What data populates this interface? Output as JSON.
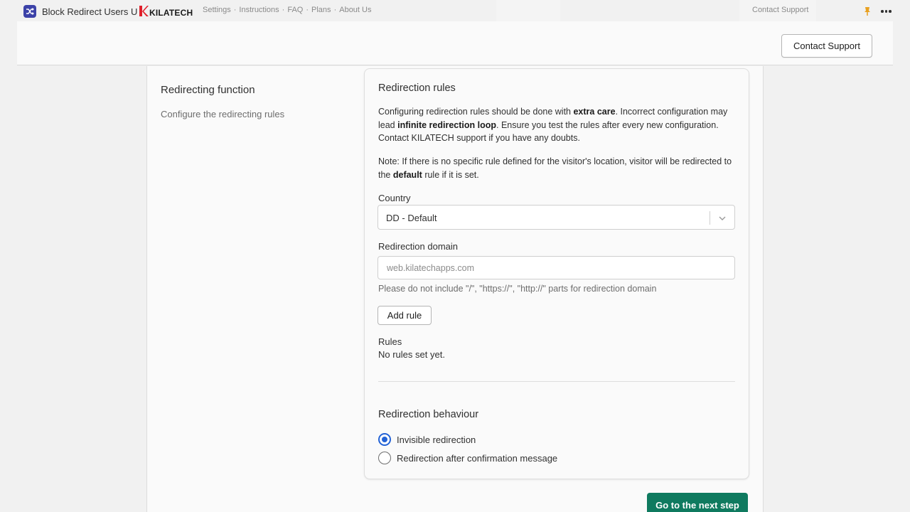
{
  "app": {
    "title": "Block Redirect Users U",
    "logo_text": "KILATECH"
  },
  "topnav": {
    "items": [
      "Settings",
      "Instructions",
      "FAQ",
      "Plans",
      "About Us"
    ],
    "separator": "·",
    "contact_link": "Contact Support"
  },
  "header": {
    "contact_button": "Contact Support"
  },
  "section": {
    "title": "Redirecting function",
    "description": "Configure the redirecting rules"
  },
  "card": {
    "title": "Redirection rules",
    "para1": {
      "t1": "Configuring redirection rules should be done with ",
      "b1": "extra care",
      "t2": ". Incorrect configuration may lead ",
      "b2": "infinite redirection loop",
      "t3": ". Ensure you test the rules after every new configuration. Contact KILATECH support if you have any doubts."
    },
    "para2": {
      "t1": "Note: If there is no specific rule defined for the visitor's location, visitor will be redirected to the ",
      "b1": "default",
      "t2": " rule if it is set."
    },
    "country_label": "Country",
    "country_value": "DD - Default",
    "domain_label": "Redirection domain",
    "domain_placeholder": "web.kilatechapps.com",
    "domain_value": "",
    "domain_help": "Please do not include \"/\", \"https://\", \"http://\" parts for redirection domain",
    "add_rule_button": "Add rule",
    "rules_label": "Rules",
    "rules_empty": "No rules set yet.",
    "behaviour_title": "Redirection behaviour",
    "behaviour_options": [
      {
        "label": "Invisible redirection",
        "checked": true
      },
      {
        "label": "Redirection after confirmation message",
        "checked": false
      }
    ]
  },
  "footer": {
    "next_button": "Go to the next step"
  },
  "colors": {
    "primary": "#0f7a5f",
    "radio_selected": "#2463d6",
    "app_icon": "#3c42a8",
    "logo_accent": "#e0202b",
    "pin": "#e8a020"
  }
}
